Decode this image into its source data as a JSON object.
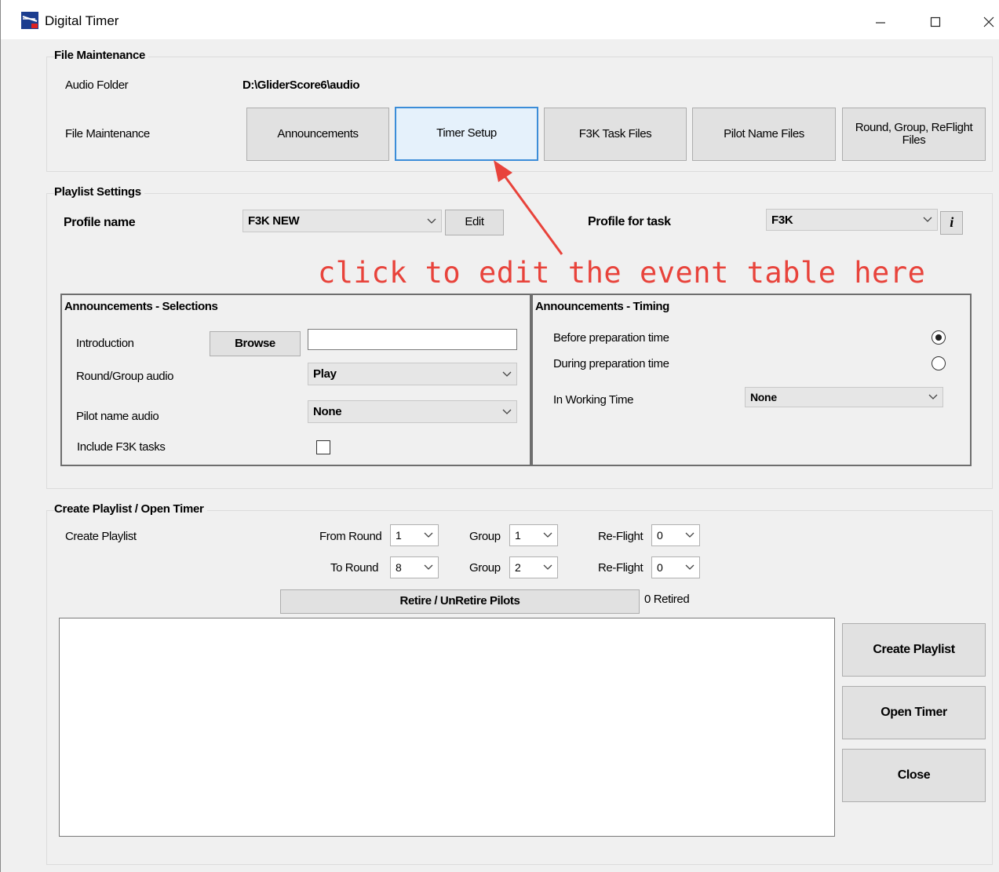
{
  "window": {
    "title": "Digital Timer",
    "controls": {
      "minimize": "—",
      "maximize": "☐",
      "close": "✕"
    }
  },
  "file_maintenance": {
    "group_title": "File Maintenance",
    "audio_folder_label": "Audio Folder",
    "audio_folder_value": "D:\\GliderScore6\\audio",
    "row_label": "File Maintenance",
    "buttons": {
      "announcements": "Announcements",
      "timer_setup": "Timer Setup",
      "f3k_task_files": "F3K Task Files",
      "pilot_name_files": "Pilot Name Files",
      "round_group_reflight_files": "Round, Group, ReFlight Files"
    }
  },
  "playlist_settings": {
    "group_title": "Playlist Settings",
    "profile_name_label": "Profile name",
    "profile_name_value": "F3K NEW",
    "edit_button": "Edit",
    "profile_for_task_label": "Profile for task",
    "profile_for_task_value": "F3K",
    "info_button": "i"
  },
  "annotation": {
    "text": "click to edit the event table here",
    "color": "#e8433b"
  },
  "announcements_selections": {
    "title": "Announcements - Selections",
    "introduction_label": "Introduction",
    "browse_button": "Browse",
    "introduction_value": "",
    "round_group_audio_label": "Round/Group audio",
    "round_group_audio_value": "Play",
    "pilot_name_audio_label": "Pilot name audio",
    "pilot_name_audio_value": "None",
    "include_f3k_tasks_label": "Include F3K tasks",
    "include_f3k_tasks_checked": false
  },
  "announcements_timing": {
    "title": "Announcements - Timing",
    "before_prep_label": "Before preparation time",
    "before_prep_selected": true,
    "during_prep_label": "During preparation time",
    "during_prep_selected": false,
    "working_time_label": "In Working Time",
    "working_time_value": "None"
  },
  "create_playlist": {
    "group_title": "Create Playlist / Open Timer",
    "row_label": "Create Playlist",
    "from_round_label": "From Round",
    "from_round_value": "1",
    "from_group_label": "Group",
    "from_group_value": "1",
    "from_reflight_label": "Re-Flight",
    "from_reflight_value": "0",
    "to_round_label": "To Round",
    "to_round_value": "8",
    "to_group_label": "Group",
    "to_group_value": "2",
    "to_reflight_label": "Re-Flight",
    "to_reflight_value": "0",
    "retire_button": "Retire / UnRetire Pilots",
    "retired_status": "0 Retired",
    "create_playlist_button": "Create Playlist",
    "open_timer_button": "Open Timer",
    "close_button": "Close"
  }
}
